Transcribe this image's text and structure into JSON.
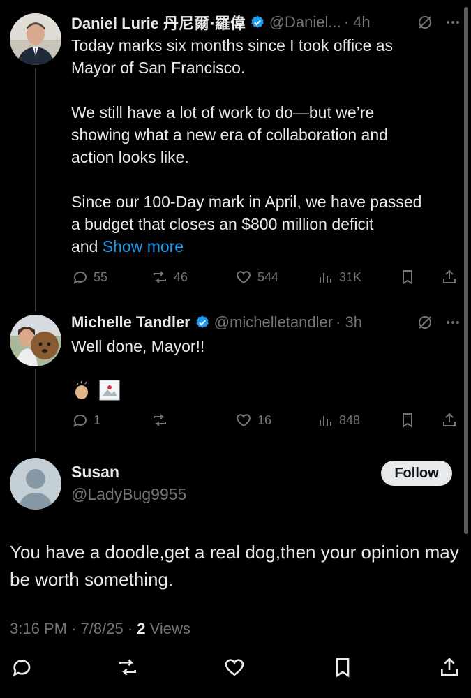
{
  "colors": {
    "background": "#000000",
    "text": "#e7e9ea",
    "muted": "#71767b",
    "link": "#1d9bf0",
    "verified": "#1d9bf0"
  },
  "tweet1": {
    "name": "Daniel Lurie 丹尼爾‧羅偉",
    "handle": "@Daniel...",
    "time": "· 4h",
    "text": "Today marks six months since I took office as\nMayor of San Francisco.\n\nWe still have a lot of work to do—but we’re\nshowing what a new era of collaboration and\naction looks like.\n\nSince our 100-Day mark in April, we have passed\na budget that closes an $800 million deficit\nand ",
    "show_more": "Show more",
    "replies": "55",
    "reposts": "46",
    "likes": "544",
    "views": "31K"
  },
  "tweet2": {
    "name": "Michelle Tandler",
    "handle": "@michelletandler",
    "time": "· 3h",
    "text": "Well done, Mayor!!",
    "emojis": [
      "clapping-hands-emoji",
      "image-emoji"
    ],
    "replies": "1",
    "reposts": "",
    "likes": "16",
    "views": "848"
  },
  "main": {
    "name": "Susan",
    "handle": "@LadyBug9955",
    "follow_label": "Follow",
    "text": "You have a doodle,get a real dog,then your opinion may be worth something.",
    "time": "3:16 PM",
    "date": "7/8/25",
    "views_count": "2",
    "views_label": "Views"
  }
}
